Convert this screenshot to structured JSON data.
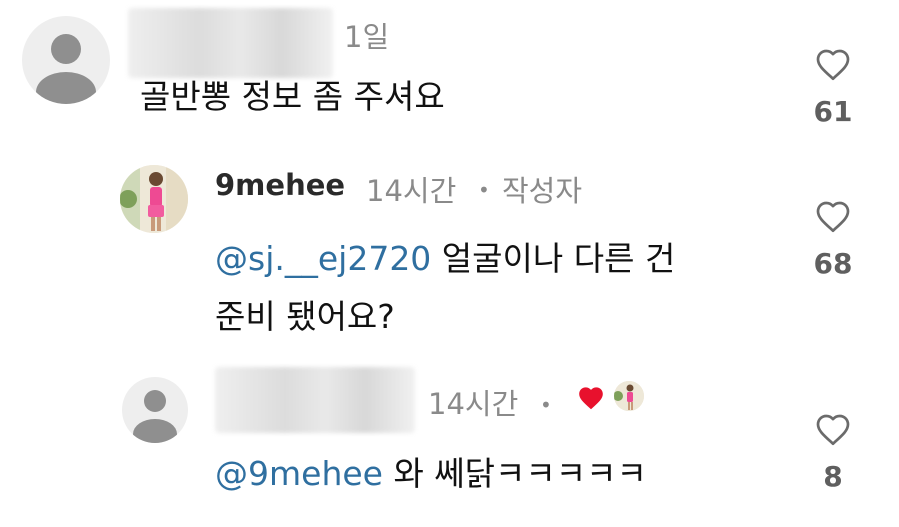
{
  "comments": [
    {
      "time": "1일",
      "text": "골반뽕 정보 좀 주셔요",
      "likes": "61"
    },
    {
      "username": "9mehee",
      "time": "14시간",
      "separator": "•",
      "author_badge": "작성자",
      "mention": "@sj.__ej2720",
      "text_line1": " 얼굴이나 다른 건",
      "text_line2": "준비 됐어요?",
      "likes": "68"
    },
    {
      "time": "14시간",
      "separator": "•",
      "mention": "@9mehee",
      "text": " 와 쎄닭ㅋㅋㅋㅋㅋ",
      "likes": "8",
      "liked_by_author": true
    }
  ],
  "colors": {
    "mention": "#2f6fa0",
    "heart_red": "#e8112d",
    "meta_gray": "#8a8a8a"
  },
  "icons": [
    "default-avatar-icon",
    "heart-outline-icon",
    "heart-filled-icon"
  ]
}
